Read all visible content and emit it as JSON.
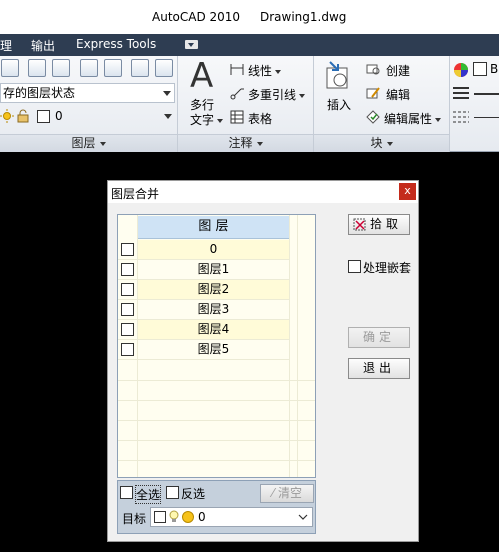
{
  "titlebar": {
    "app": "AutoCAD 2010",
    "document": "Drawing1.dwg"
  },
  "menubar": {
    "tabs": [
      "理",
      "输出",
      "Express Tools"
    ]
  },
  "ribbon": {
    "layer_panel": {
      "title": "图层",
      "layer_state": "存的图层状态",
      "current_layer": "0"
    },
    "annotation_panel": {
      "title": "注释",
      "mtext_line1": "多行",
      "mtext_line2": "文字",
      "linear": "线性",
      "multileader": "多重引线",
      "table": "表格"
    },
    "block_panel": {
      "title": "块",
      "insert": "插入",
      "create": "创建",
      "edit": "编辑",
      "edit_attributes": "编辑属性"
    },
    "properties_panel": {
      "color_fragment": "B"
    }
  },
  "dialog": {
    "title": "图层合并",
    "close_glyph": "x",
    "list_header": "图 层",
    "layers": [
      "0",
      "图层1",
      "图层2",
      "图层3",
      "图层4",
      "图层5"
    ],
    "pick_button": "拾取",
    "nested_label": "处理嵌套",
    "ok_button": "确定",
    "exit_button": "退出",
    "select_all": "全选",
    "invert_selection": "反选",
    "clear_button": "清空",
    "target_label": "目标",
    "target_value": "0"
  }
}
